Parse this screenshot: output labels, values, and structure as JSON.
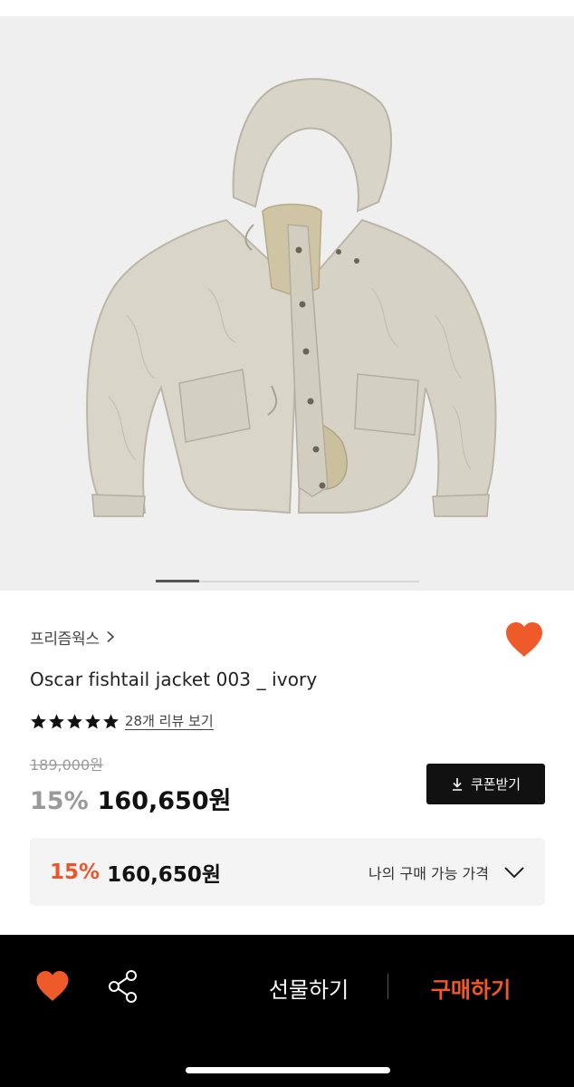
{
  "product": {
    "brand": "프리즘웍스",
    "title": "Oscar fishtail jacket 003 _ ivory",
    "review_text": "28개 리뷰 보기",
    "rating_stars": 5,
    "original_price": "189,000원",
    "discount": "15%",
    "price": "160,650원",
    "coupon_label": "쿠폰받기"
  },
  "my_price": {
    "discount": "15%",
    "price": "160,650원",
    "label": "나의 구매 가능 가격"
  },
  "gallery": {
    "current_index": 1,
    "total": 6
  },
  "bottom_bar": {
    "gift_label": "선물하기",
    "buy_label": "구매하기"
  },
  "colors": {
    "accent": "#e8582c",
    "buy": "#f0582b",
    "heart": "#ee5a2a",
    "jacket": "#d9d5c9"
  }
}
